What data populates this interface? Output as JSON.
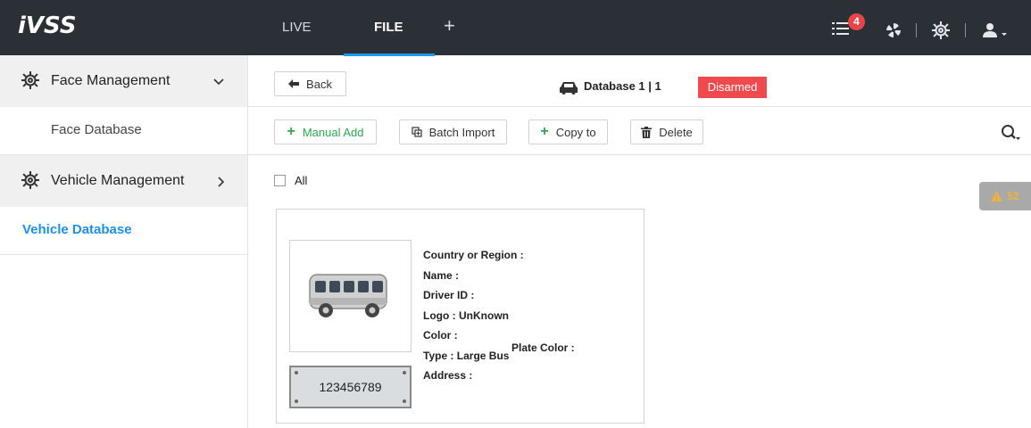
{
  "app": {
    "logo": "iVSS"
  },
  "top_nav": {
    "tabs": [
      {
        "label": "LIVE"
      },
      {
        "label": "FILE"
      }
    ],
    "add_tab_label": "+",
    "task_badge_count": "4",
    "icons": [
      "list-icon",
      "fan-icon",
      "gear-icon",
      "user-icon"
    ]
  },
  "sidebar": {
    "groups": [
      {
        "label": "Face Management",
        "chevron": "expanded",
        "items": [
          {
            "label": "Face Database"
          }
        ]
      },
      {
        "label": "Vehicle Management",
        "chevron": "collapsed",
        "items": [
          {
            "label": "Vehicle Database"
          }
        ]
      }
    ]
  },
  "main": {
    "back_label": "Back",
    "database_title": "Database 1 | 1",
    "status": "Disarmed",
    "status_color": "#f04a4f",
    "toolbar": {
      "manual_add": "Manual Add",
      "batch_import": "Batch Import",
      "copy_to": "Copy to",
      "delete": "Delete"
    },
    "select_all_label": "All",
    "alert_count": "52",
    "card": {
      "plate_number": "123456789",
      "fields": {
        "country_label": "Country or Region :",
        "name_label": "Name :",
        "driver_label": "Driver ID :",
        "logo_label": "Logo :",
        "logo_value": "UnKnown",
        "color_label": "Color :",
        "plate_color_label": "Plate Color :",
        "type_label": "Type :",
        "type_value": "Large Bus",
        "address_label": "Address :"
      }
    }
  },
  "colors": {
    "accent": "#1e9be8",
    "topbar": "#2b2f36",
    "active_sidebar_text": "#1e90e6"
  }
}
